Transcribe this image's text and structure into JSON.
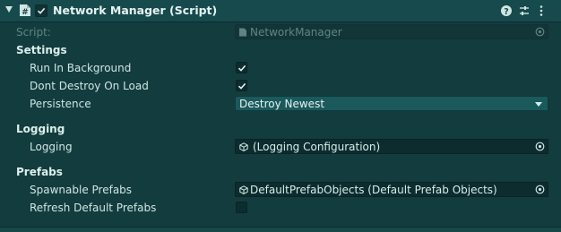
{
  "component": {
    "title": "Network Manager (Script)",
    "enabled": true
  },
  "script_field": {
    "label": "Script:",
    "value": "NetworkManager"
  },
  "sections": {
    "settings": "Settings",
    "logging": "Logging",
    "prefabs": "Prefabs"
  },
  "settings": {
    "run_in_background": {
      "label": "Run In Background",
      "checked": true
    },
    "dont_destroy_on_load": {
      "label": "Dont Destroy On Load",
      "checked": true
    },
    "persistence": {
      "label": "Persistence",
      "value": "Destroy Newest"
    }
  },
  "logging": {
    "label": "Logging",
    "value": "(Logging Configuration)"
  },
  "prefabs": {
    "spawnable": {
      "label": "Spawnable Prefabs",
      "value": "DefaultPrefabObjects (Default Prefab Objects)"
    },
    "refresh_default": {
      "label": "Refresh Default Prefabs",
      "checked": false
    }
  },
  "icons": {
    "header": [
      "help-icon",
      "presets-icon",
      "kebab-menu-icon"
    ],
    "object": "scriptable-object-icon",
    "picker": "object-picker-icon"
  }
}
